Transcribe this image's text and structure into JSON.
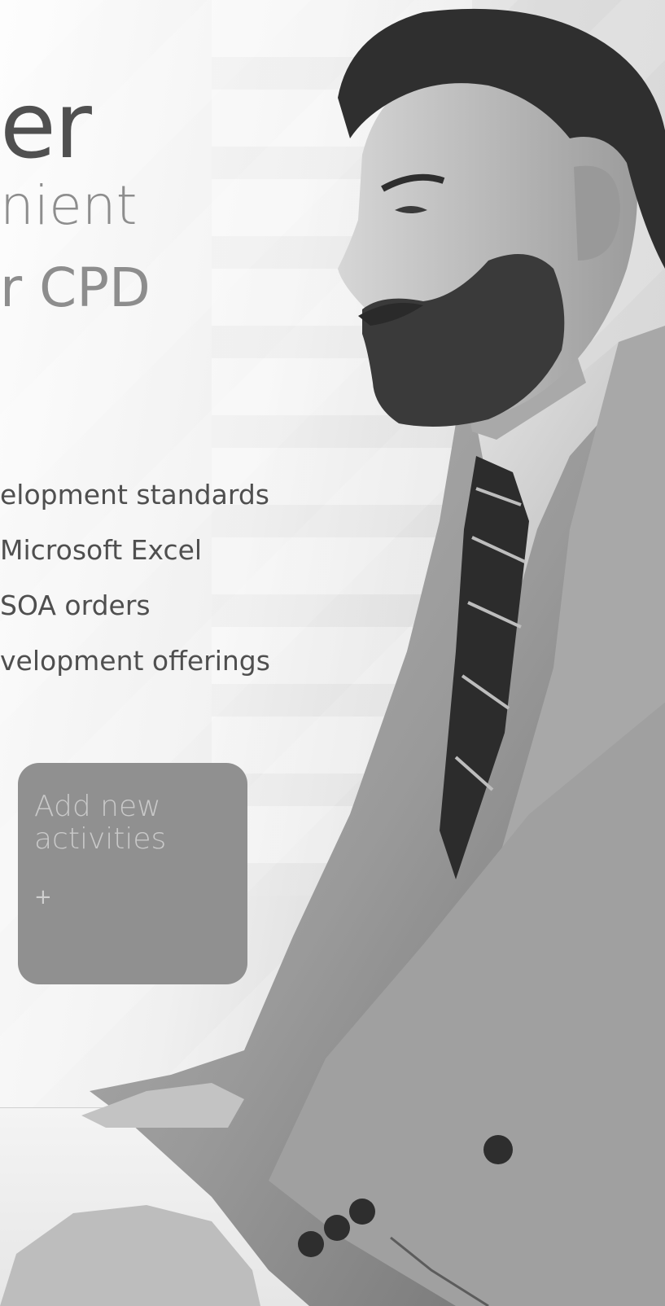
{
  "headline": {
    "line_1": "er",
    "line_2": "nient",
    "line_3": "r CPD"
  },
  "features": [
    "elopment standards",
    "Microsoft Excel",
    "SOA orders",
    "velopment offerings"
  ],
  "add_card": {
    "label": "Add new activities",
    "plus": "+"
  },
  "colors": {
    "card_background": "#909090",
    "headline_dark": "#505050",
    "headline_light": "#8d8d8d",
    "body_text": "#4f4f4f"
  },
  "image": {
    "style": "black-and-white photo",
    "icons": [
      "plus-icon"
    ]
  }
}
